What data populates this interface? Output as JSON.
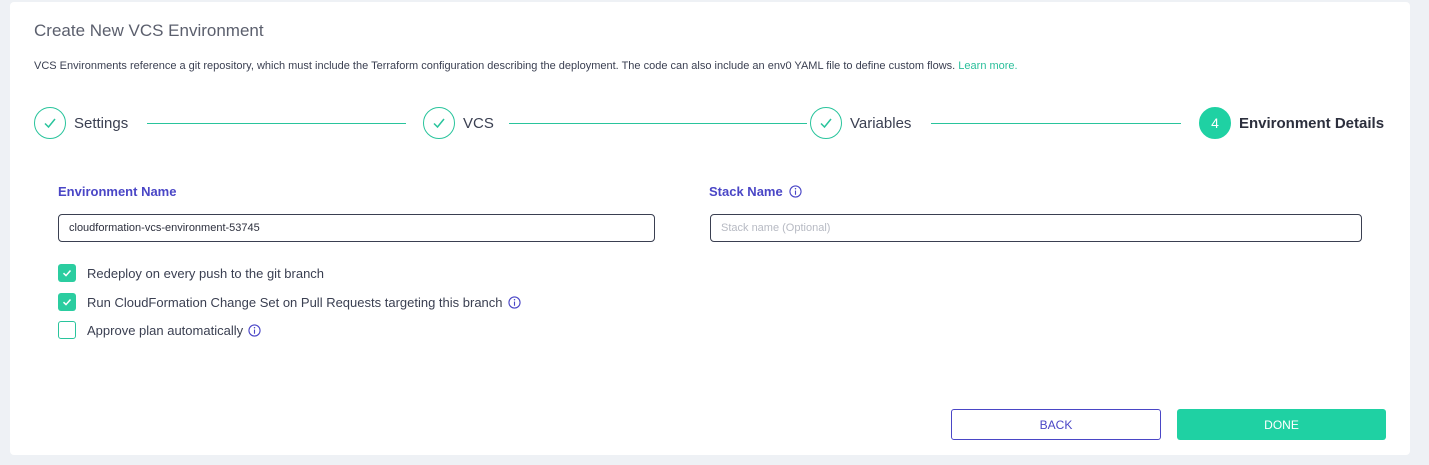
{
  "header": {
    "title": "Create New VCS Environment",
    "description": "VCS Environments reference a git repository, which must include the Terraform configuration describing the deployment. The code can also include an env0 YAML file to define custom flows.",
    "learn_more": "Learn more."
  },
  "stepper": {
    "steps": [
      {
        "label": "Settings",
        "state": "complete"
      },
      {
        "label": "VCS",
        "state": "complete"
      },
      {
        "label": "Variables",
        "state": "complete"
      },
      {
        "label": "Environment Details",
        "state": "active",
        "number": "4"
      }
    ]
  },
  "form": {
    "environment_name": {
      "label": "Environment Name",
      "value": "cloudformation-vcs-environment-53745"
    },
    "stack_name": {
      "label": "Stack Name",
      "placeholder": "Stack name (Optional)",
      "value": ""
    },
    "options": [
      {
        "label": "Redeploy on every push to the git branch",
        "checked": true,
        "info": false
      },
      {
        "label": "Run CloudFormation Change Set on Pull Requests targeting this branch",
        "checked": true,
        "info": true
      },
      {
        "label": "Approve plan automatically",
        "checked": false,
        "info": true
      }
    ]
  },
  "actions": {
    "back_label": "BACK",
    "done_label": "DONE"
  },
  "colors": {
    "accent": "#1fd1a3",
    "primary": "#4a46c6",
    "link": "#2bbf9b"
  }
}
